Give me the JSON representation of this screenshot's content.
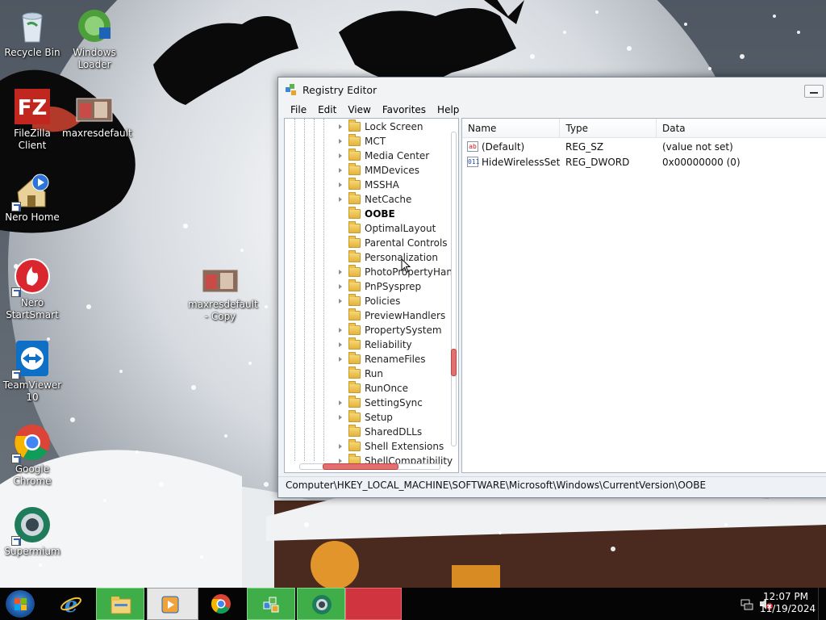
{
  "desktop": {
    "icons": [
      {
        "label": "Recycle Bin",
        "icon": "recycle-bin-icon"
      },
      {
        "label": "Windows Loader",
        "icon": "windows-loader-icon"
      },
      {
        "label": "FileZilla Client",
        "icon": "filezilla-icon"
      },
      {
        "label": "maxresdefault",
        "icon": "image-file-icon"
      },
      {
        "label": "Nero Home",
        "icon": "nero-home-icon"
      },
      {
        "label": "Nero StartSmart",
        "icon": "nero-startsmart-icon"
      },
      {
        "label": "maxresdefault - Copy",
        "icon": "image-file-icon"
      },
      {
        "label": "TeamViewer 10",
        "icon": "teamviewer-icon"
      },
      {
        "label": "Google Chrome",
        "icon": "chrome-icon"
      },
      {
        "label": "Supermium",
        "icon": "supermium-icon"
      }
    ]
  },
  "regedit": {
    "title": "Registry Editor",
    "menu": [
      "File",
      "Edit",
      "View",
      "Favorites",
      "Help"
    ],
    "tree": [
      {
        "label": "Lock Screen",
        "expandable": true,
        "selected": false
      },
      {
        "label": "MCT",
        "expandable": true,
        "selected": false
      },
      {
        "label": "Media Center",
        "expandable": true,
        "selected": false
      },
      {
        "label": "MMDevices",
        "expandable": true,
        "selected": false
      },
      {
        "label": "MSSHA",
        "expandable": true,
        "selected": false
      },
      {
        "label": "NetCache",
        "expandable": true,
        "selected": false
      },
      {
        "label": "OOBE",
        "expandable": false,
        "selected": true
      },
      {
        "label": "OptimalLayout",
        "expandable": false,
        "selected": false
      },
      {
        "label": "Parental Controls",
        "expandable": false,
        "selected": false
      },
      {
        "label": "Personalization",
        "expandable": false,
        "selected": false
      },
      {
        "label": "PhotoPropertyHan",
        "expandable": true,
        "selected": false
      },
      {
        "label": "PnPSysprep",
        "expandable": true,
        "selected": false
      },
      {
        "label": "Policies",
        "expandable": true,
        "selected": false
      },
      {
        "label": "PreviewHandlers",
        "expandable": false,
        "selected": false
      },
      {
        "label": "PropertySystem",
        "expandable": true,
        "selected": false
      },
      {
        "label": "Reliability",
        "expandable": true,
        "selected": false
      },
      {
        "label": "RenameFiles",
        "expandable": true,
        "selected": false
      },
      {
        "label": "Run",
        "expandable": false,
        "selected": false
      },
      {
        "label": "RunOnce",
        "expandable": false,
        "selected": false
      },
      {
        "label": "SettingSync",
        "expandable": true,
        "selected": false
      },
      {
        "label": "Setup",
        "expandable": true,
        "selected": false
      },
      {
        "label": "SharedDLLs",
        "expandable": false,
        "selected": false
      },
      {
        "label": "Shell Extensions",
        "expandable": true,
        "selected": false
      },
      {
        "label": "ShellCompatibility",
        "expandable": true,
        "selected": false
      }
    ],
    "columns": {
      "name": "Name",
      "type": "Type",
      "data": "Data"
    },
    "values": [
      {
        "name": "(Default)",
        "type": "REG_SZ",
        "data": "(value not set)",
        "icon": "ab"
      },
      {
        "name": "HideWirelessSet...",
        "type": "REG_DWORD",
        "data": "0x00000000 (0)",
        "icon": "011"
      }
    ],
    "status_path": "Computer\\HKEY_LOCAL_MACHINE\\SOFTWARE\\Microsoft\\Windows\\CurrentVersion\\OOBE"
  },
  "taskbar": {
    "time": "12:07 PM",
    "date": "11/19/2024",
    "buttons": [
      "internet-explorer-icon",
      "file-explorer-icon",
      "media-player-icon",
      "chrome-icon",
      "regedit-icon",
      "supermium-icon"
    ]
  },
  "colors": {
    "taskbar_active": "#3fae49",
    "taskbar_red": "#d0353f",
    "scroll_thumb": "#e56e6e"
  }
}
